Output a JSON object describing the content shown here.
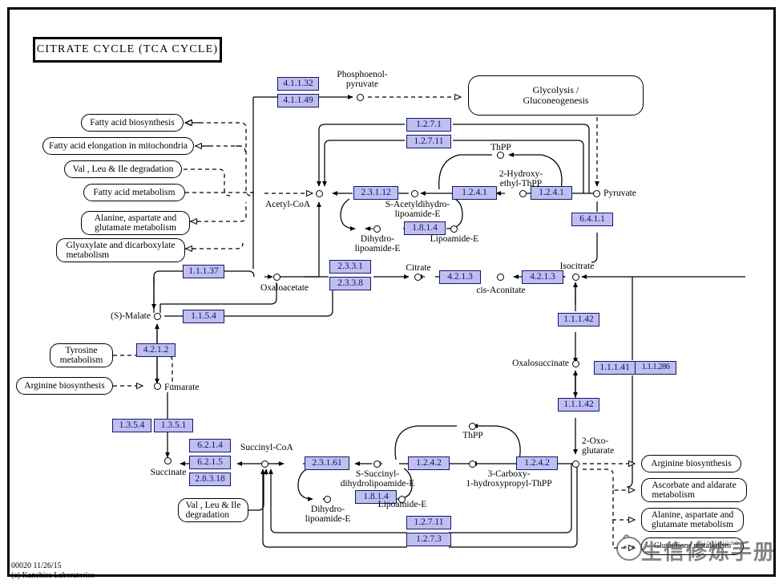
{
  "page": {
    "title": "CITRATE CYCLE (TCA CYCLE)",
    "map_id_line": "00020 11/26/15",
    "copyright_line": "(c) Kanehisa Laboratories",
    "colors": {
      "enzyme_fill": "#bfbfef",
      "enzyme_border": "#16166e",
      "enzyme_text": "#101070",
      "line": "#000000",
      "background": "#ffffff"
    }
  },
  "enzymes": [
    {
      "id": "ec_4_1_1_32",
      "label": "4.1.1.32"
    },
    {
      "id": "ec_4_1_1_49",
      "label": "4.1.1.49"
    },
    {
      "id": "ec_1_2_7_1",
      "label": "1.2.7.1"
    },
    {
      "id": "ec_1_2_7_11",
      "label": "1.2.7.11"
    },
    {
      "id": "ec_2_3_1_12",
      "label": "2.3.1.12"
    },
    {
      "id": "ec_1_2_4_1a",
      "label": "1.2.4.1"
    },
    {
      "id": "ec_1_2_4_1b",
      "label": "1.2.4.1"
    },
    {
      "id": "ec_1_8_1_4a",
      "label": "1.8.1.4"
    },
    {
      "id": "ec_6_4_1_1",
      "label": "6.4.1.1"
    },
    {
      "id": "ec_1_1_1_37",
      "label": "1.1.1.37"
    },
    {
      "id": "ec_2_3_3_1",
      "label": "2.3.3.1"
    },
    {
      "id": "ec_2_3_3_8",
      "label": "2.3.3.8"
    },
    {
      "id": "ec_4_2_1_3a",
      "label": "4.2.1.3"
    },
    {
      "id": "ec_4_2_1_3b",
      "label": "4.2.1.3"
    },
    {
      "id": "ec_1_1_5_4",
      "label": "1.1.5.4"
    },
    {
      "id": "ec_1_1_1_42a",
      "label": "1.1.1.42"
    },
    {
      "id": "ec_1_1_1_41",
      "label": "1.1.1.41"
    },
    {
      "id": "ec_1_1_1_286",
      "label": "1.1.1.286"
    },
    {
      "id": "ec_1_1_1_42b",
      "label": "1.1.1.42"
    },
    {
      "id": "ec_4_2_1_2",
      "label": "4.2.1.2"
    },
    {
      "id": "ec_1_3_5_4",
      "label": "1.3.5.4"
    },
    {
      "id": "ec_1_3_5_1",
      "label": "1.3.5.1"
    },
    {
      "id": "ec_6_2_1_4",
      "label": "6.2.1.4"
    },
    {
      "id": "ec_6_2_1_5",
      "label": "6.2.1.5"
    },
    {
      "id": "ec_2_8_3_18",
      "label": "2.8.3.18"
    },
    {
      "id": "ec_2_3_1_61",
      "label": "2.3.1.61"
    },
    {
      "id": "ec_1_2_4_2a",
      "label": "1.2.4.2"
    },
    {
      "id": "ec_1_2_4_2b",
      "label": "1.2.4.2"
    },
    {
      "id": "ec_1_8_1_4b",
      "label": "1.8.1.4"
    },
    {
      "id": "ec_1_2_7_11b",
      "label": "1.2.7.11"
    },
    {
      "id": "ec_1_2_7_3",
      "label": "1.2.7.3"
    }
  ],
  "map_links": [
    {
      "id": "map_glycolysis",
      "label": "Glycolysis /\nGluconeogenesis"
    },
    {
      "id": "map_fa_biosynthesis",
      "label": "Fatty acid biosynthesis"
    },
    {
      "id": "map_fa_elongation",
      "label": "Fatty acid elongation in mitochondria"
    },
    {
      "id": "map_vli_degradation",
      "label": "Val , Leu & Ile degradation"
    },
    {
      "id": "map_fa_metabolism",
      "label": "Fatty acid metabolism"
    },
    {
      "id": "map_ala_asp_glu",
      "label": "Alanine, aspartate and\nglutamate metabolism"
    },
    {
      "id": "map_glyoxylate",
      "label": "Glyoxylate and dicarboxylate\nmetabolism"
    },
    {
      "id": "map_tyrosine",
      "label": "Tyrosine\nmetabolism"
    },
    {
      "id": "map_arginine_biosyn_l",
      "label": "Arginine biosynthesis"
    },
    {
      "id": "map_vli_degradation_b",
      "label": "Val , Leu & Ile\ndegradation"
    },
    {
      "id": "map_arginine_biosyn_r",
      "label": "Arginine biosynthesis"
    },
    {
      "id": "map_ascorbate",
      "label": "Ascorbate and aldarate\nmetabolism"
    },
    {
      "id": "map_ala_asp_glu_r",
      "label": "Alanine, aspartate and\nglutamate metabolism"
    },
    {
      "id": "map_glutathione",
      "label": "Glutathione metabolism"
    }
  ],
  "compounds": [
    {
      "id": "cpd_pep",
      "label": "Phosphoenol-\npyruvate"
    },
    {
      "id": "cpd_pyruvate",
      "label": "Pyruvate"
    },
    {
      "id": "cpd_acetyl_coa",
      "label": "Acetyl-CoA"
    },
    {
      "id": "cpd_thpp_top",
      "label": "ThPP"
    },
    {
      "id": "cpd_hydroxyethyl",
      "label": "2-Hydroxy-\nethyl-ThPP"
    },
    {
      "id": "cpd_s_acetyl",
      "label": "S-Acetyldihydro-\nlipoamide-E"
    },
    {
      "id": "cpd_dihydro_top",
      "label": "Dihydro-\nlipoamide-E"
    },
    {
      "id": "cpd_lipoamide_top",
      "label": "Lipoamide-E"
    },
    {
      "id": "cpd_oxaloacetate",
      "label": "Oxaloacetate"
    },
    {
      "id": "cpd_citrate",
      "label": "Citrate"
    },
    {
      "id": "cpd_cis_aconitate",
      "label": "cis-Aconitate"
    },
    {
      "id": "cpd_isocitrate",
      "label": "Isocitrate"
    },
    {
      "id": "cpd_s_malate",
      "label": "(S)-Malate"
    },
    {
      "id": "cpd_oxalosuccinate",
      "label": "Oxalosuccinate"
    },
    {
      "id": "cpd_fumarate",
      "label": "Fumarate"
    },
    {
      "id": "cpd_succinate",
      "label": "Succinate"
    },
    {
      "id": "cpd_succinyl_coa",
      "label": "Succinyl-CoA"
    },
    {
      "id": "cpd_2_oxoglutarate",
      "label": "2-Oxo-\nglutarate"
    },
    {
      "id": "cpd_thpp_bottom",
      "label": "ThPP"
    },
    {
      "id": "cpd_s_succinyl",
      "label": "S-Succinyl-\ndihydrolipoamide-E"
    },
    {
      "id": "cpd_carboxy",
      "label": "3-Carboxy-\n1-hydroxypropyl-ThPP"
    },
    {
      "id": "cpd_dihydro_bot",
      "label": "Dihydro-\nlipoamide-E"
    },
    {
      "id": "cpd_lipoamide_bot",
      "label": "Lipoamide-E"
    }
  ],
  "watermark": {
    "text": "生信修炼手册",
    "sub": "biotrainee"
  }
}
